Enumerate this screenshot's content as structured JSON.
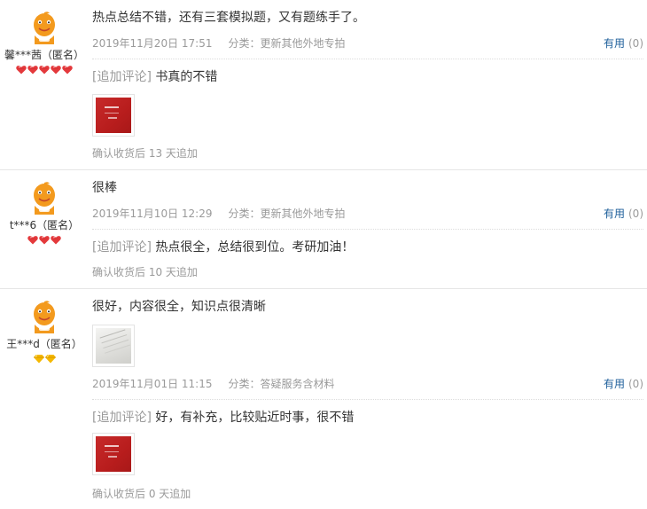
{
  "reviews": [
    {
      "user": "馨***茜（匿名）",
      "badge_type": "red-heart-diamond",
      "badge_count": 5,
      "text": "热点总结不错，还有三套模拟题，又有题练手了。",
      "date": "2019年11月20日 17:51",
      "category": "分类：更新其他外地专拍",
      "useful_label": "有用",
      "useful_count": "(0)",
      "followup_tag": "[追加评论]",
      "followup_text": "书真的不错",
      "followup_image": "red-book-cover",
      "confirm": "确认收货后 13 天追加"
    },
    {
      "user": "t***6（匿名）",
      "badge_type": "red-heart-diamond",
      "badge_count": 3,
      "text": "很棒",
      "date": "2019年11月10日 12:29",
      "category": "分类：更新其他外地专拍",
      "useful_label": "有用",
      "useful_count": "(0)",
      "followup_tag": "[追加评论]",
      "followup_text": "热点很全，总结很到位。考研加油！",
      "confirm": "确认收货后 10 天追加"
    },
    {
      "user": "王***d（匿名）",
      "badge_type": "yellow-diamond",
      "badge_count": 2,
      "text": "很好，内容很全，知识点很清晰",
      "review_image": "book-page-photo",
      "date": "2019年11月01日 11:15",
      "category": "分类：答疑服务含材料",
      "useful_label": "有用",
      "useful_count": "(0)",
      "followup_tag": "[追加评论]",
      "followup_text": "好，有补充，比较贴近时事，很不错",
      "followup_image": "red-book-cover",
      "confirm": "确认收货后 0 天追加"
    }
  ],
  "colors": {
    "useful_link": "#1c5e9a",
    "muted": "#9a9a9a",
    "heart": "#e4393c",
    "diamond": "#f5b800",
    "avatar": "#f39a1e"
  }
}
